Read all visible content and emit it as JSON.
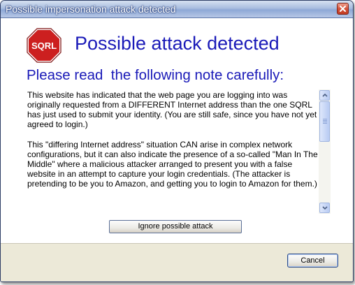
{
  "window": {
    "title": "Possible impersonation attack detected"
  },
  "icon": {
    "label": "SQRL",
    "name": "stop-sign-icon",
    "color": "#cc1f1f"
  },
  "heading": "Possible attack detected",
  "subheading": "Please read  the following note carefully:",
  "note": {
    "paragraphs": [
      "This website has indicated that the web page you are logging into was originally requested from a DIFFERENT Internet address than the one SQRL has just used to submit your identity. (You are still safe, since you have not yet agreed to login.)",
      "This \"differing Internet address\" situation CAN arise in complex network configurations, but it can also indicate the presence of a so-called \"Man In The Middle\" where a malicious attacker arranged to present you with a false website in an attempt to capture your login credentials. (The attacker is pretending to be you to Amazon, and getting you to login to Amazon for them.)"
    ]
  },
  "buttons": {
    "ignore": "Ignore possible attack",
    "cancel": "Cancel"
  },
  "colors": {
    "heading": "#1a1ab8",
    "accent": "#0a246a"
  }
}
